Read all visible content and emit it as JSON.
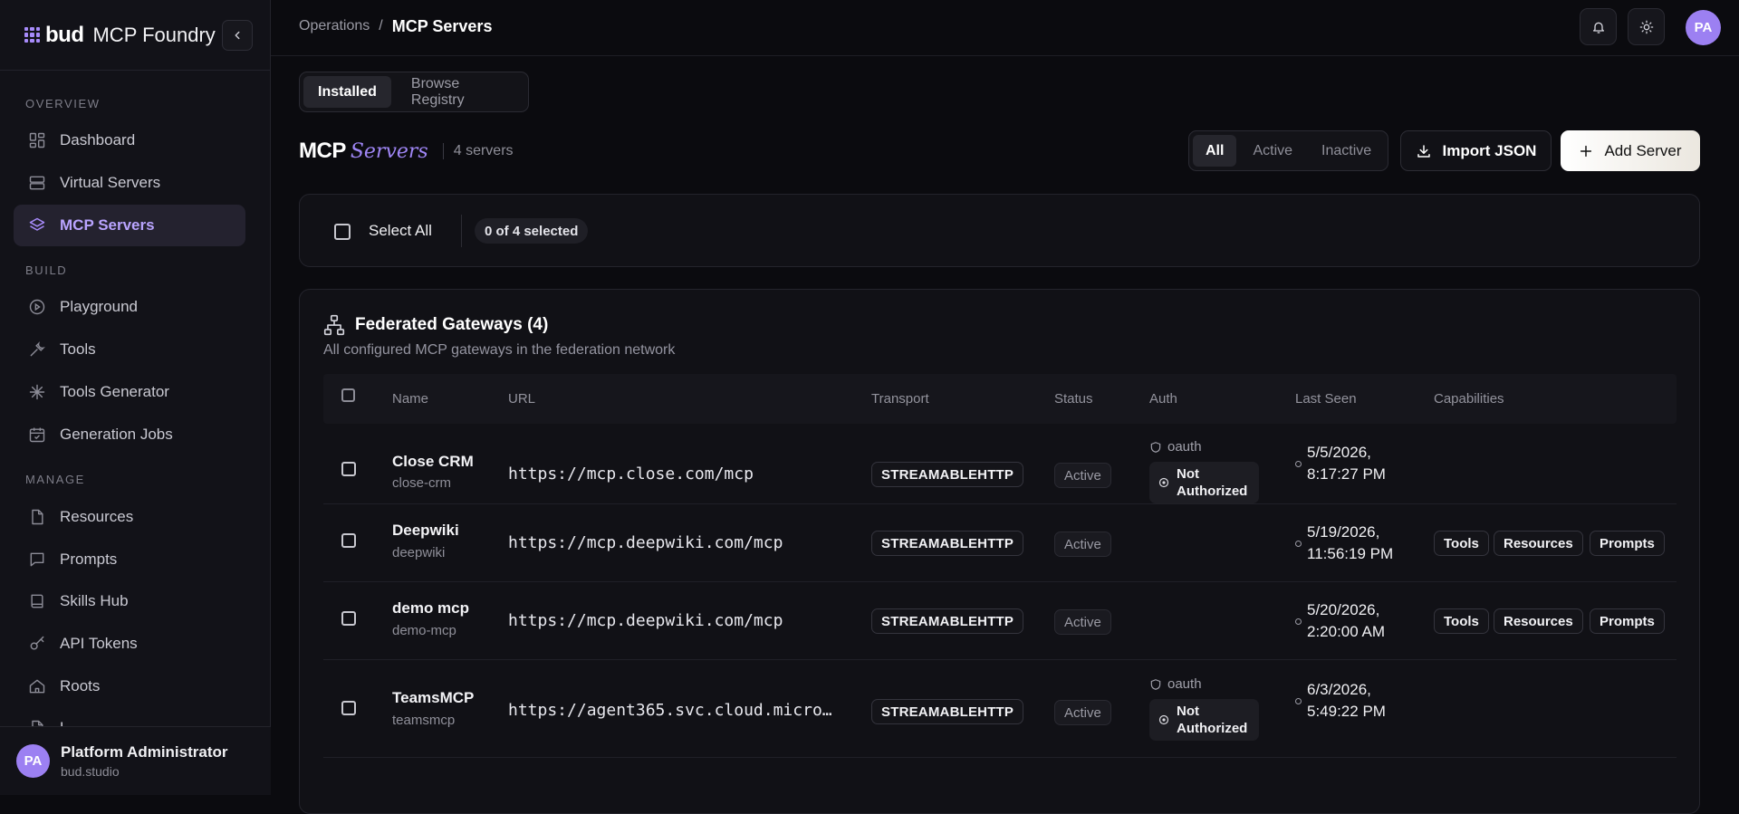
{
  "brand": {
    "bold": "bud",
    "rest": "MCP Foundry"
  },
  "sidebar": {
    "sections": {
      "overview": "OVERVIEW",
      "build": "BUILD",
      "manage": "MANAGE"
    },
    "items": [
      {
        "label": "Dashboard",
        "icon": "dashboard-icon"
      },
      {
        "label": "Virtual Servers",
        "icon": "server-icon"
      },
      {
        "label": "MCP Servers",
        "icon": "layers-icon",
        "active": true
      },
      {
        "label": "Playground",
        "icon": "play-circle-icon"
      },
      {
        "label": "Tools",
        "icon": "wrench-icon"
      },
      {
        "label": "Tools Generator",
        "icon": "sparkle-icon"
      },
      {
        "label": "Generation Jobs",
        "icon": "calendar-check-icon"
      },
      {
        "label": "Resources",
        "icon": "file-icon"
      },
      {
        "label": "Prompts",
        "icon": "message-icon"
      },
      {
        "label": "Skills Hub",
        "icon": "book-icon"
      },
      {
        "label": "API Tokens",
        "icon": "key-icon"
      },
      {
        "label": "Roots",
        "icon": "home-icon"
      },
      {
        "label": "L",
        "icon": "file-icon"
      }
    ],
    "user": {
      "initials": "PA",
      "name": "Platform Administrator",
      "org": "bud.studio"
    }
  },
  "header": {
    "breadcrumb": [
      "Operations",
      "/",
      "MCP Servers"
    ],
    "avatar": "PA"
  },
  "tabs": [
    "Installed",
    "Browse Registry"
  ],
  "title": {
    "main": "MCP",
    "accent": "Servers",
    "count": "4 servers"
  },
  "filters": [
    "All",
    "Active",
    "Inactive"
  ],
  "actions": {
    "import": "Import JSON",
    "add": "Add Server"
  },
  "selection": {
    "label": "Select All",
    "badge": "0 of 4 selected"
  },
  "gateways": {
    "title": "Federated Gateways (4)",
    "subtitle": "All configured MCP gateways in the federation network",
    "columns": [
      "Name",
      "URL",
      "Transport",
      "Status",
      "Auth",
      "Last Seen",
      "Capabilities"
    ],
    "rows": [
      {
        "name": "Close CRM",
        "slug": "close-crm",
        "url": "https://mcp.close.com/mcp",
        "transport": "STREAMABLEHTTP",
        "status": "Active",
        "auth_type": "oauth",
        "auth_status": [
          "Not",
          "Authorized"
        ],
        "last_seen": [
          "5/5/2026,",
          "8:17:27 PM"
        ],
        "capabilities": []
      },
      {
        "name": "Deepwiki",
        "slug": "deepwiki",
        "url": "https://mcp.deepwiki.com/mcp",
        "transport": "STREAMABLEHTTP",
        "status": "Active",
        "auth_type": "",
        "auth_status": [],
        "last_seen": [
          "5/19/2026,",
          "11:56:19 PM"
        ],
        "capabilities": [
          "Tools",
          "Resources",
          "Prompts"
        ]
      },
      {
        "name": "demo mcp",
        "slug": "demo-mcp",
        "url": "https://mcp.deepwiki.com/mcp",
        "transport": "STREAMABLEHTTP",
        "status": "Active",
        "auth_type": "",
        "auth_status": [],
        "last_seen": [
          "5/20/2026,",
          "2:20:00 AM"
        ],
        "capabilities": [
          "Tools",
          "Resources",
          "Prompts"
        ]
      },
      {
        "name": "TeamsMCP",
        "slug": "teamsmcp",
        "url": "https://agent365.svc.cloud.micros…",
        "transport": "STREAMABLEHTTP",
        "status": "Active",
        "auth_type": "oauth",
        "auth_status": [
          "Not",
          "Authorized"
        ],
        "last_seen": [
          "6/3/2026,",
          "5:49:22 PM"
        ],
        "capabilities": []
      }
    ]
  },
  "colors": {
    "accent": "#a78bfa",
    "background": "#0b0b0f",
    "panel": "#111116"
  }
}
